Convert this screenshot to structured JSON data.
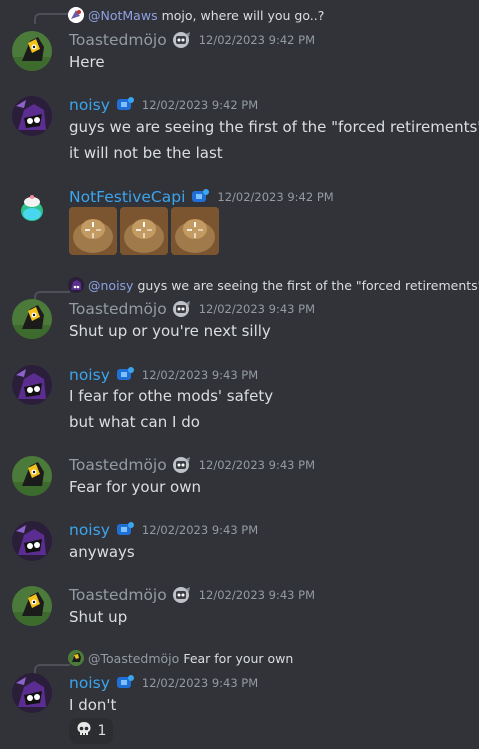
{
  "users": {
    "toast": "Toastedmöjo",
    "noisy": "noisy",
    "capi": "NotFestiveCapi"
  },
  "replies": [
    {
      "name": "@NotMaws",
      "text": "mojo, where will you go..?"
    },
    {
      "name": "@noisy",
      "text": "guys we are seeing the first of the \"forced retirements\""
    },
    {
      "name": "@Toastedmöjo",
      "text": "Fear for your own"
    }
  ],
  "messages": [
    {
      "timestamp": "12/02/2023 9:42 PM",
      "lines": [
        "Here"
      ]
    },
    {
      "timestamp": "12/02/2023 9:42 PM",
      "lines": [
        "guys we are seeing the first of the \"forced retirements\"",
        "it will not be the last"
      ]
    },
    {
      "timestamp": "12/02/2023 9:42 PM",
      "lines": []
    },
    {
      "timestamp": "12/02/2023 9:43 PM",
      "lines": [
        "Shut up or you're next silly"
      ]
    },
    {
      "timestamp": "12/02/2023 9:43 PM",
      "lines": [
        "I fear for othe mods' safety",
        "but what can I do"
      ]
    },
    {
      "timestamp": "12/02/2023 9:43 PM",
      "lines": [
        "Fear for your own"
      ]
    },
    {
      "timestamp": "12/02/2023 9:43 PM",
      "lines": [
        "anyways"
      ]
    },
    {
      "timestamp": "12/02/2023 9:43 PM",
      "lines": [
        "Shut up"
      ]
    },
    {
      "timestamp": "12/02/2023 9:43 PM",
      "lines": [
        "I don't"
      ]
    }
  ],
  "reaction": {
    "emoji": "skull",
    "count": "1"
  },
  "colors": {
    "background": "#313338",
    "gray_name": "#949ba4",
    "blue_name": "#3ba5ee",
    "reply_name": "#8ea1e1"
  }
}
